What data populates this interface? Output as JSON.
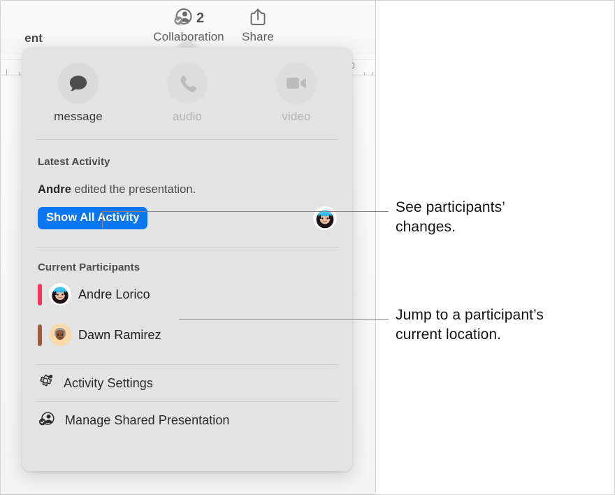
{
  "window": {
    "toolbar": {
      "document_label": "ent",
      "collaboration_label": "Collaboration",
      "collaboration_count": "2",
      "share_label": "Share",
      "collaboration_icon": "person-checkmark-icon",
      "share_icon": "share-up-arrow-icon"
    },
    "ruler": {
      "origin_label": "0"
    }
  },
  "popover": {
    "quick_actions": [
      {
        "label": "message",
        "icon": "speech-bubble-icon",
        "enabled": true
      },
      {
        "label": "audio",
        "icon": "phone-handset-icon",
        "enabled": false
      },
      {
        "label": "video",
        "icon": "video-camera-icon",
        "enabled": false
      }
    ],
    "latest_activity": {
      "title": "Latest Activity",
      "actor": "Andre",
      "activity_text": " edited the presentation.",
      "button_label": "Show All Activity",
      "avatar": {
        "name": "Andre Lorico",
        "icon": "memoji-andre-avatar"
      }
    },
    "current_participants": {
      "title": "Current Participants",
      "items": [
        {
          "name": "Andre Lorico",
          "color": "#f7335c",
          "avatar_icon": "memoji-andre-avatar"
        },
        {
          "name": "Dawn Ramirez",
          "color": "#a05a3c",
          "avatar_icon": "memoji-dawn-avatar"
        }
      ]
    },
    "menu_items": [
      {
        "label": "Activity Settings",
        "icon": "gear-badge-icon"
      },
      {
        "label": "Manage Shared Presentation",
        "icon": "person-checkmark-icon"
      }
    ]
  },
  "callouts": [
    {
      "line1": "See participants’",
      "line2": "changes."
    },
    {
      "line1": "Jump to a participant’s",
      "line2": "current location."
    }
  ],
  "colors": {
    "accent_blue": "#0a76f0",
    "popover_bg": "#e3e3e3",
    "divider": "#cfcfcf",
    "participant_1": "#f7335c",
    "participant_2": "#a05a3c"
  }
}
